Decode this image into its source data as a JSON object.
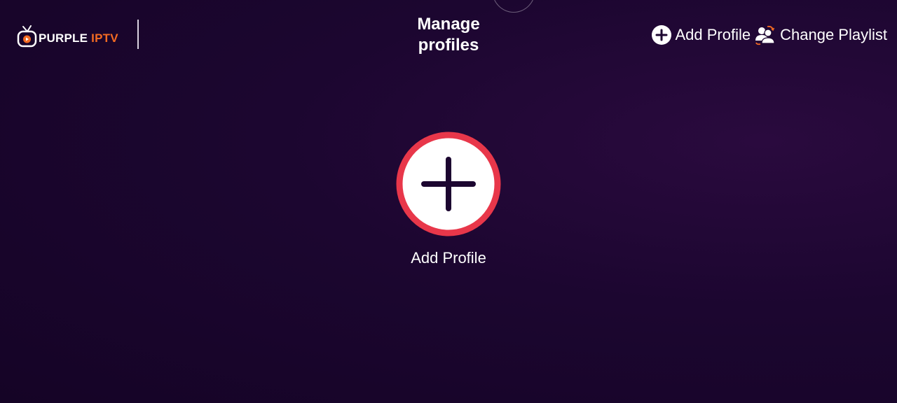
{
  "app": {
    "logo_text_main": "PURPLE",
    "logo_text_accent": "IPTV",
    "brand_color": "#f26a22"
  },
  "header": {
    "title": "Manage\nprofiles",
    "actions": [
      {
        "label": "Add Profile",
        "icon": "plus-circle-icon"
      },
      {
        "label": "Change Playlist",
        "icon": "switch-users-icon"
      }
    ]
  },
  "main": {
    "add_profile": {
      "label": "Add Profile",
      "icon": "plus-icon",
      "ring_color": "#e8374a"
    }
  },
  "colors": {
    "background": "#1c0630",
    "text": "#ffffff"
  }
}
